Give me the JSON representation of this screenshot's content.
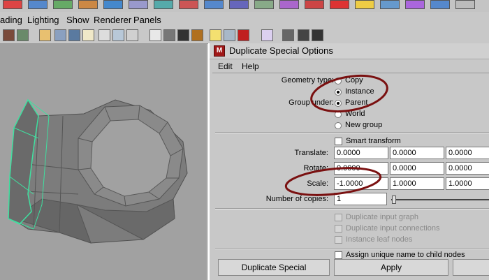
{
  "menubar": {
    "items": [
      "ading",
      "Lighting",
      "Show",
      "Renderer",
      "Panels"
    ]
  },
  "dialog": {
    "title": "Duplicate Special Options",
    "menu": [
      "Edit",
      "Help"
    ],
    "geometry_type": {
      "label": "Geometry type:",
      "options": [
        "Copy",
        "Instance"
      ],
      "selected": "Instance"
    },
    "group_under": {
      "label": "Group under:",
      "options": [
        "Parent",
        "World",
        "New group"
      ],
      "selected": "Parent"
    },
    "smart_transform": {
      "label": "Smart transform",
      "checked": false
    },
    "translate": {
      "label": "Translate:",
      "values": [
        "0.0000",
        "0.0000",
        "0.0000"
      ]
    },
    "rotate": {
      "label": "Rotate:",
      "values": [
        "0.0000",
        "0.0000",
        "0.0000"
      ]
    },
    "scale": {
      "label": "Scale:",
      "values": [
        "-1.0000",
        "1.0000",
        "1.0000"
      ]
    },
    "number_of_copies": {
      "label": "Number of copies:",
      "value": "1"
    },
    "disabled_options": [
      "Duplicate input graph",
      "Duplicate input connections",
      "Instance leaf nodes"
    ],
    "assign_unique": {
      "label": "Assign unique name to child nodes",
      "checked": false
    },
    "buttons": {
      "duplicate": "Duplicate Special",
      "apply": "Apply"
    }
  },
  "colors": {
    "viewport_bg": "#a1a1a1",
    "mesh_fill": "#777777",
    "selection_edge": "#3fe0a0",
    "annotation": "#7a1010"
  },
  "icons": [
    "shelf-icons",
    "toolbar-icons",
    "maya-app-icon"
  ]
}
